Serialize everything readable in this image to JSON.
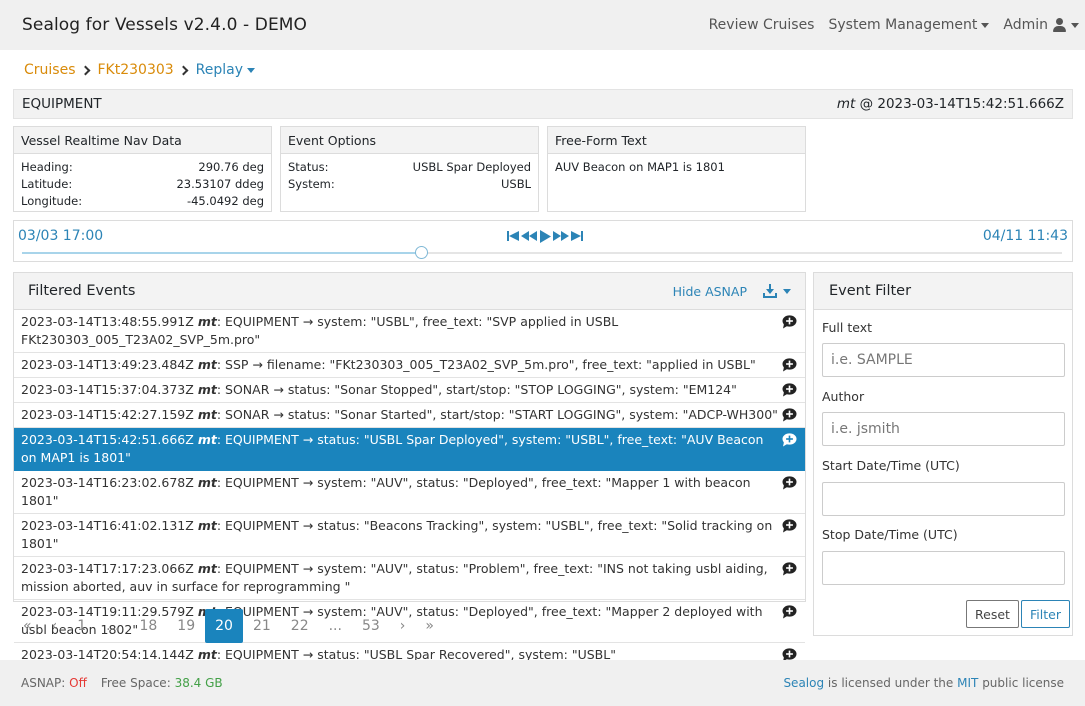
{
  "navbar": {
    "title": "Sealog for Vessels v2.4.0 - DEMO",
    "review_cruises": "Review Cruises",
    "system_management": "System Management",
    "admin": "Admin"
  },
  "breadcrumb": {
    "cruises": "Cruises",
    "cruise_id": "FKt230303",
    "replay": "Replay"
  },
  "current_event": {
    "value": "EQUIPMENT",
    "author": "mt",
    "at": "@",
    "timestamp": "2023-03-14T15:42:51.666Z"
  },
  "nav_data": {
    "title": "Vessel Realtime Nav Data",
    "rows": [
      {
        "label": "Heading:",
        "value": "290.76 deg"
      },
      {
        "label": "Latitude:",
        "value": "23.53107 ddeg"
      },
      {
        "label": "Longitude:",
        "value": "-45.0492 deg"
      }
    ]
  },
  "event_options": {
    "title": "Event Options",
    "rows": [
      {
        "label": "Status:",
        "value": "USBL Spar Deployed"
      },
      {
        "label": "System:",
        "value": "USBL"
      }
    ]
  },
  "free_form": {
    "title": "Free-Form Text",
    "text": "AUV Beacon on MAP1 is 1801"
  },
  "replay": {
    "start": "03/03 17:00",
    "end": "04/11 11:43",
    "progress": 0.384
  },
  "events": {
    "title": "Filtered Events",
    "hide_asnap": "Hide ASNAP",
    "rows": [
      {
        "ts": "2023-03-14T13:48:55.991Z",
        "author": "mt",
        "value": ": EQUIPMENT",
        "detail": "system: \"USBL\", free_text: \"SVP applied in USBL FKt230303_005_T23A02_SVP_5m.pro\""
      },
      {
        "ts": "2023-03-14T13:49:23.484Z",
        "author": "mt",
        "value": ": SSP",
        "detail": "filename: \"FKt230303_005_T23A02_SVP_5m.pro\", free_text: \"applied in USBL\""
      },
      {
        "ts": "2023-03-14T15:37:04.373Z",
        "author": "mt",
        "value": ": SONAR",
        "detail": "status: \"Sonar Stopped\", start/stop: \"STOP LOGGING\", system: \"EM124\""
      },
      {
        "ts": "2023-03-14T15:42:27.159Z",
        "author": "mt",
        "value": ": SONAR",
        "detail": "status: \"Sonar Started\", start/stop: \"START LOGGING\", system: \"ADCP-WH300\""
      },
      {
        "ts": "2023-03-14T15:42:51.666Z",
        "author": "mt",
        "value": ": EQUIPMENT",
        "detail": "status: \"USBL Spar Deployed\", system: \"USBL\", free_text: \"AUV Beacon on MAP1 is 1801\"",
        "active": true
      },
      {
        "ts": "2023-03-14T16:23:02.678Z",
        "author": "mt",
        "value": ": EQUIPMENT",
        "detail": "system: \"AUV\", status: \"Deployed\", free_text: \"Mapper 1 with beacon 1801\""
      },
      {
        "ts": "2023-03-14T16:41:02.131Z",
        "author": "mt",
        "value": ": EQUIPMENT",
        "detail": "status: \"Beacons Tracking\", system: \"USBL\", free_text: \"Solid tracking on 1801\""
      },
      {
        "ts": "2023-03-14T17:17:23.066Z",
        "author": "mt",
        "value": ": EQUIPMENT",
        "detail": "system: \"AUV\", status: \"Problem\", free_text: \"INS not taking usbl aiding, mission aborted, auv in surface for reprogramming \""
      },
      {
        "ts": "2023-03-14T19:11:29.579Z",
        "author": "mt",
        "value": ": EQUIPMENT",
        "detail": "system: \"AUV\", status: \"Deployed\", free_text: \"Mapper 2 deployed with usbl beacon 1802\""
      },
      {
        "ts": "2023-03-14T20:54:14.144Z",
        "author": "mt",
        "value": ": EQUIPMENT",
        "detail": "status: \"USBL Spar Recovered\", system: \"USBL\""
      }
    ]
  },
  "pagination": [
    "«",
    "‹",
    "1",
    "...",
    "18",
    "19",
    "20",
    "21",
    "22",
    "...",
    "53",
    "›",
    "»"
  ],
  "pagination_active": "20",
  "filter": {
    "title": "Event Filter",
    "fulltext_label": "Full text",
    "fulltext_placeholder": "i.e. SAMPLE",
    "author_label": "Author",
    "author_placeholder": "i.e. jsmith",
    "start_label": "Start Date/Time (UTC)",
    "stop_label": "Stop Date/Time (UTC)",
    "reset": "Reset",
    "filter": "Filter"
  },
  "footer": {
    "asnap_label": "ASNAP:",
    "asnap_value": "Off",
    "space_label": "Free Space:",
    "space_value": "38.4 GB",
    "sealog": "Sealog",
    "lic1": "is licensed under the",
    "mit": "MIT",
    "lic2": "public license"
  },
  "colors": {
    "accent": "#1a84bd",
    "breadcrumb": "#d98b0a",
    "off": "#e53935",
    "space": "#43a047"
  }
}
